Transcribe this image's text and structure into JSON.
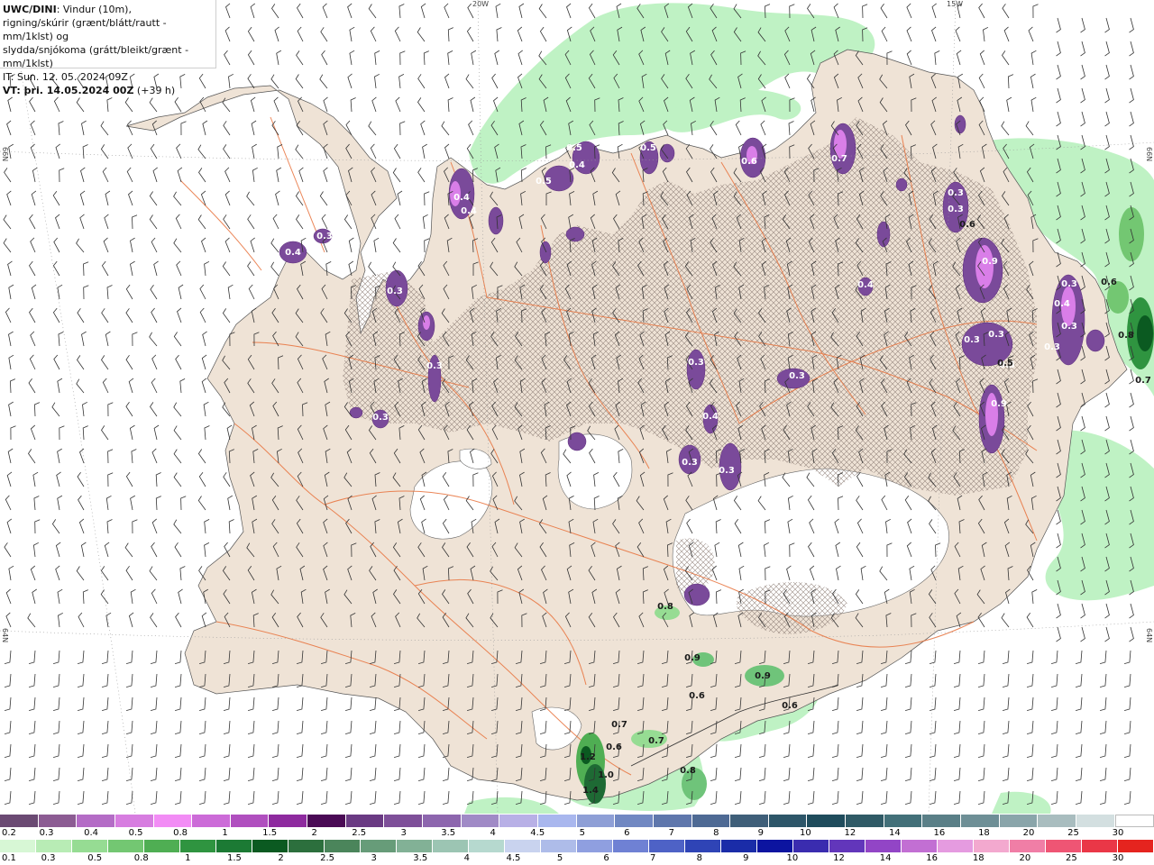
{
  "title": {
    "model": "UWC/DINI",
    "line1_rest": ": Vindur (10m),",
    "line2": "rigning/skúrir (grænt/blátt/rautt - mm/1klst) og",
    "line3": "slydda/snjókoma (grátt/bleikt/grænt - mm/1klst)",
    "line4": "IT: Sun. 12. 05. 2024 09Z",
    "vt_label": "VT:",
    "vt_value": " þri. 14.05.2024 00Z",
    "vt_offset": " (+39 h)"
  },
  "grid_labels": {
    "lon_20w": "20W",
    "lon_15w": "15W",
    "lat_66n_left": "66N",
    "lat_66n_right": "66N",
    "lat_64n_left": "64N",
    "lat_64n_right": "64N"
  },
  "colors": {
    "land": "#efe3d6",
    "rain_light": "#bff2c4",
    "rain_mid": "#6fc47a",
    "rain_dark": "#1e6a34",
    "snow_purple": "#7a4a9a",
    "snow_pink": "#d97ee8",
    "road": "#e8723c",
    "ice": "#ffffff"
  },
  "map_labels": [
    {
      "text": "0.4",
      "kind": "snow"
    },
    {
      "text": "0.3",
      "kind": "snow"
    },
    {
      "text": "0.3",
      "kind": "snow"
    },
    {
      "text": "0.4",
      "kind": "snow"
    },
    {
      "text": "0.4",
      "kind": "snow"
    },
    {
      "text": "0.5",
      "kind": "snow"
    },
    {
      "text": "0.5",
      "kind": "snow"
    },
    {
      "text": "0.4",
      "kind": "snow"
    },
    {
      "text": "0.5",
      "kind": "snow"
    },
    {
      "text": "0.6",
      "kind": "snow"
    },
    {
      "text": "0.7",
      "kind": "snow"
    },
    {
      "text": "0.3",
      "kind": "snow"
    },
    {
      "text": "0.3",
      "kind": "snow"
    },
    {
      "text": "0.6",
      "kind": "rain"
    },
    {
      "text": "0.9",
      "kind": "snow"
    },
    {
      "text": "0.4",
      "kind": "snow"
    },
    {
      "text": "0.3",
      "kind": "snow"
    },
    {
      "text": "0.3",
      "kind": "snow"
    },
    {
      "text": "0.3",
      "kind": "snow"
    },
    {
      "text": "0.3",
      "kind": "snow"
    },
    {
      "text": "0.9",
      "kind": "snow"
    },
    {
      "text": "0.5",
      "kind": "snow"
    },
    {
      "text": "0.4",
      "kind": "snow"
    },
    {
      "text": "0.3",
      "kind": "snow"
    },
    {
      "text": "0.6",
      "kind": "rain"
    },
    {
      "text": "0.8",
      "kind": "rain"
    },
    {
      "text": "0.7",
      "kind": "rain"
    },
    {
      "text": "0.5",
      "kind": "rain"
    },
    {
      "text": "0.3",
      "kind": "snow"
    },
    {
      "text": "0.3",
      "kind": "snow"
    },
    {
      "text": "0.4",
      "kind": "snow"
    },
    {
      "text": "0.3",
      "kind": "snow"
    },
    {
      "text": "0.3",
      "kind": "snow"
    },
    {
      "text": "0.3",
      "kind": "snow"
    },
    {
      "text": "0.8",
      "kind": "rain"
    },
    {
      "text": "0.9",
      "kind": "rain"
    },
    {
      "text": "0.9",
      "kind": "rain"
    },
    {
      "text": "0.6",
      "kind": "rain"
    },
    {
      "text": "0.6",
      "kind": "rain"
    },
    {
      "text": "0.7",
      "kind": "rain"
    },
    {
      "text": "0.6",
      "kind": "rain"
    },
    {
      "text": "0.7",
      "kind": "rain"
    },
    {
      "text": "0.8",
      "kind": "rain"
    },
    {
      "text": "1.0",
      "kind": "rain"
    },
    {
      "text": "1.2",
      "kind": "rain"
    },
    {
      "text": "1.4",
      "kind": "rain"
    },
    {
      "text": "0.3",
      "kind": "snow"
    }
  ],
  "legend_snow": {
    "colors": [
      "#6b4a73",
      "#8c5c93",
      "#b46cc6",
      "#d77de0",
      "#f28cf5",
      "#cc6bd8",
      "#b04fbf",
      "#8e2a9f",
      "#4a0a55",
      "#6a3a83",
      "#7e4f99",
      "#8d66ae",
      "#a08ac6",
      "#b8b0e6",
      "#a9b7ee",
      "#8e9fd6",
      "#7188c2",
      "#5f77ac",
      "#4e6a94",
      "#3f5f79",
      "#2d5669",
      "#1f4c5c",
      "#2f5a66",
      "#437079",
      "#5a7f87",
      "#6e8f96",
      "#8aa5aa",
      "#a9bdbf",
      "#d3dfe0",
      "#ffffff"
    ],
    "labels": [
      "0.2",
      "0.3",
      "0.4",
      "0.5",
      "0.8",
      "1",
      "1.5",
      "2",
      "2.5",
      "3",
      "3.5",
      "4",
      "4.5",
      "5",
      "6",
      "7",
      "8",
      "9",
      "10",
      "12",
      "14",
      "16",
      "18",
      "20",
      "25",
      "30"
    ]
  },
  "legend_rain": {
    "colors": [
      "#d7f7d5",
      "#b8ecb5",
      "#96dc93",
      "#73c772",
      "#4fae53",
      "#2f9440",
      "#1c7a34",
      "#0b5a21",
      "#2c6f3d",
      "#4b855b",
      "#679c79",
      "#82b196",
      "#9cc5b3",
      "#b6d9cf",
      "#c9d3ef",
      "#aebce9",
      "#8f9fe0",
      "#6f81d4",
      "#4e62c6",
      "#2f44b6",
      "#1a2ca8",
      "#0c14a0",
      "#3a2caf",
      "#6236bb",
      "#9245c6",
      "#c26fd3",
      "#e59be0",
      "#f3a9cf",
      "#f07ea6",
      "#ef5574",
      "#ea3747",
      "#e5241f"
    ],
    "labels": [
      "0.1",
      "0.3",
      "0.5",
      "0.8",
      "1",
      "1.5",
      "2",
      "2.5",
      "3",
      "3.5",
      "4",
      "4.5",
      "5",
      "6",
      "7",
      "8",
      "9",
      "10",
      "12",
      "14",
      "16",
      "18",
      "20",
      "25",
      "30"
    ]
  }
}
